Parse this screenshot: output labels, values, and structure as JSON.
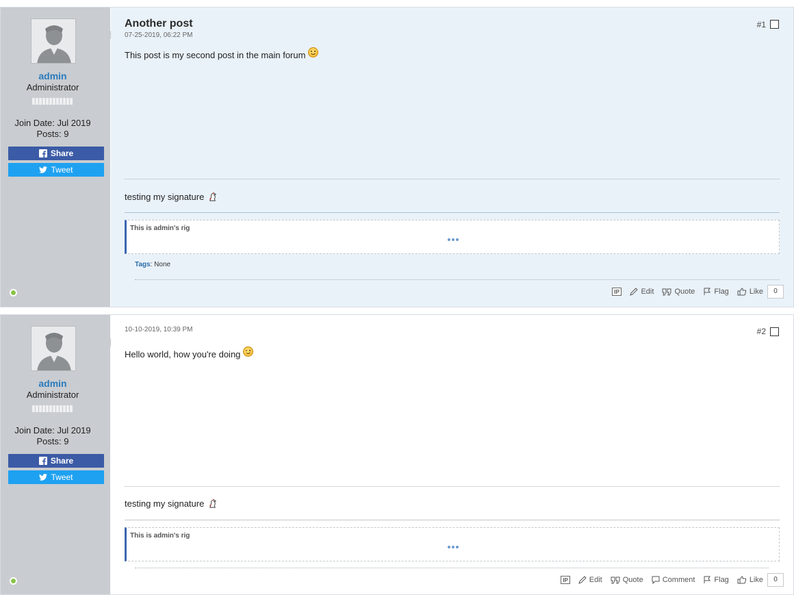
{
  "posts": [
    {
      "user": {
        "name": "admin",
        "title": "Administrator",
        "join_date": "Join Date: Jul 2019",
        "posts": "Posts: 9",
        "share_label": "Share",
        "tweet_label": "Tweet",
        "online": true
      },
      "title": "Another post",
      "date": "07-25-2019, 06:22 PM",
      "number": "#1",
      "text": "This post is my second post in the main forum",
      "smiley": "smile-icon",
      "signature": "testing my signature",
      "rig": "This is admin's rig",
      "tags_label": "Tags",
      "tags_value": ": None",
      "actions": {
        "ip": "IP",
        "edit": "Edit",
        "quote": "Quote",
        "flag": "Flag",
        "like": "Like",
        "like_count": "0"
      }
    },
    {
      "user": {
        "name": "admin",
        "title": "Administrator",
        "join_date": "Join Date: Jul 2019",
        "posts": "Posts: 9",
        "share_label": "Share",
        "tweet_label": "Tweet",
        "online": true
      },
      "date": "10-10-2019, 10:39 PM",
      "number": "#2",
      "text": "Hello world, how you're doing",
      "smiley": "wink-icon",
      "signature": "testing my signature",
      "rig": "This is admin's rig",
      "actions": {
        "ip": "IP",
        "edit": "Edit",
        "quote": "Quote",
        "comment": "Comment",
        "flag": "Flag",
        "like": "Like",
        "like_count": "0"
      }
    }
  ],
  "colors": {
    "accent": "#2a7bbd",
    "facebook": "#3b5ba6",
    "twitter": "#1ea1f1",
    "online": "#8bc34a",
    "post_bg": "#eaf2f9"
  }
}
